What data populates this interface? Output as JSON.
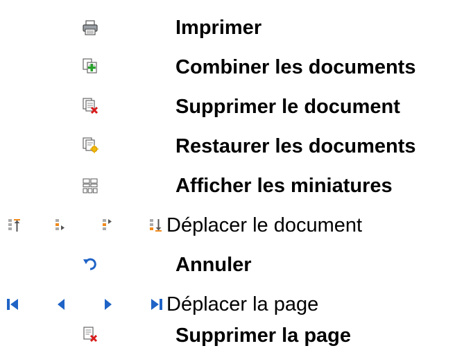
{
  "legend": {
    "items": [
      {
        "id": "print",
        "icon": "printer-icon",
        "label": "Imprimer"
      },
      {
        "id": "combine",
        "icon": "add-document-icon",
        "label": "Combiner les documents"
      },
      {
        "id": "delete-doc",
        "icon": "delete-document-icon",
        "label": "Supprimer le document"
      },
      {
        "id": "restore",
        "icon": "restore-documents-icon",
        "label": "Restaurer les documents"
      },
      {
        "id": "thumbs",
        "icon": "thumbnails-icon",
        "label": "Afficher les miniatures"
      },
      {
        "id": "move-doc",
        "icons": [
          "move-to-top-icon",
          "move-up-icon",
          "move-down-icon",
          "move-to-bottom-icon"
        ],
        "label": "Déplacer le document"
      },
      {
        "id": "undo",
        "icon": "undo-icon",
        "label": "Annuler"
      },
      {
        "id": "move-page",
        "icons": [
          "first-page-icon",
          "previous-page-icon",
          "next-page-icon",
          "last-page-icon"
        ],
        "label": "Déplacer la page"
      },
      {
        "id": "delete-page",
        "icon": "delete-page-icon",
        "label": "Supprimer la page"
      }
    ]
  },
  "colors": {
    "nav_blue": "#1f63c6",
    "delete_red": "#d81b1b",
    "add_green": "#27a12b",
    "restore_yellow": "#f0b400",
    "move_orange": "#f08a1c",
    "icon_gray": "#8a8a8a"
  }
}
